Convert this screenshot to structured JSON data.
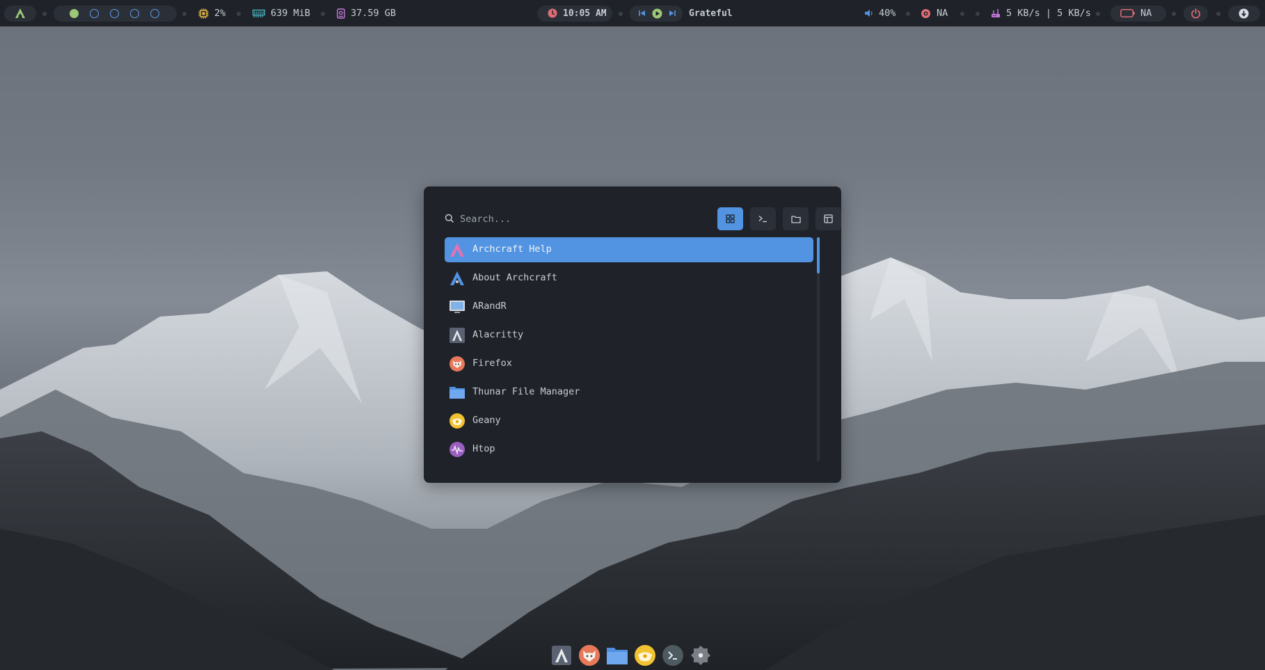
{
  "colors": {
    "accent": "#5294e2",
    "bar_bg": "#1f2329",
    "pill_bg": "#2b3038",
    "text": "#c8ccd4",
    "workspace_active": "#9ec875",
    "cpu": "#e5b84a",
    "memory": "#4bbfcc",
    "disk": "#c678dd",
    "clock": "#e06c75",
    "net": "#c678dd",
    "power": "#e06c75"
  },
  "topbar": {
    "launcher_icon": "archcraft-logo-icon",
    "workspaces": [
      {
        "state": "active"
      },
      {
        "state": "empty"
      },
      {
        "state": "empty"
      },
      {
        "state": "empty"
      },
      {
        "state": "empty"
      }
    ],
    "cpu": {
      "icon": "cpu-icon",
      "value": "2%"
    },
    "memory": {
      "icon": "memory-icon",
      "value": "639 MiB"
    },
    "disk": {
      "icon": "disk-icon",
      "value": "37.59 GB"
    },
    "clock": {
      "icon": "clock-icon",
      "value": "10:05 AM"
    },
    "media": {
      "icons": [
        "previous-icon",
        "play-icon",
        "next-icon"
      ],
      "track": "Grateful"
    },
    "volume": {
      "icon": "volume-icon",
      "value": "40%"
    },
    "brightness": {
      "icon": "brightness-icon",
      "value": "NA"
    },
    "network": {
      "icon": "network-icon",
      "value": "5 KB/s | 5 KB/s"
    },
    "battery": {
      "icon": "battery-icon",
      "value": "NA"
    },
    "power_icon": "power-icon",
    "updates_icon": "updates-icon"
  },
  "launcher": {
    "search_placeholder": "Search...",
    "modes": [
      {
        "name": "apps",
        "icon": "grid-icon",
        "active": true
      },
      {
        "name": "run",
        "icon": "terminal-prompt-icon",
        "active": false
      },
      {
        "name": "files",
        "icon": "folder-icon",
        "active": false
      },
      {
        "name": "windows",
        "icon": "window-icon",
        "active": false
      }
    ],
    "apps": [
      {
        "label": "Archcraft Help",
        "icon": "archcraft-help-icon",
        "selected": true
      },
      {
        "label": "About Archcraft",
        "icon": "archcraft-about-icon",
        "selected": false
      },
      {
        "label": "ARandR",
        "icon": "monitor-icon",
        "selected": false
      },
      {
        "label": "Alacritty",
        "icon": "alacritty-icon",
        "selected": false
      },
      {
        "label": "Firefox",
        "icon": "firefox-icon",
        "selected": false
      },
      {
        "label": "Thunar File Manager",
        "icon": "folder-icon",
        "selected": false
      },
      {
        "label": "Geany",
        "icon": "geany-icon",
        "selected": false
      },
      {
        "label": "Htop",
        "icon": "htop-icon",
        "selected": false
      }
    ]
  },
  "dock": {
    "items": [
      {
        "icon": "alacritty-icon"
      },
      {
        "icon": "firefox-icon"
      },
      {
        "icon": "folder-icon"
      },
      {
        "icon": "geany-icon"
      },
      {
        "icon": "terminal-icon"
      },
      {
        "icon": "settings-icon"
      }
    ]
  }
}
